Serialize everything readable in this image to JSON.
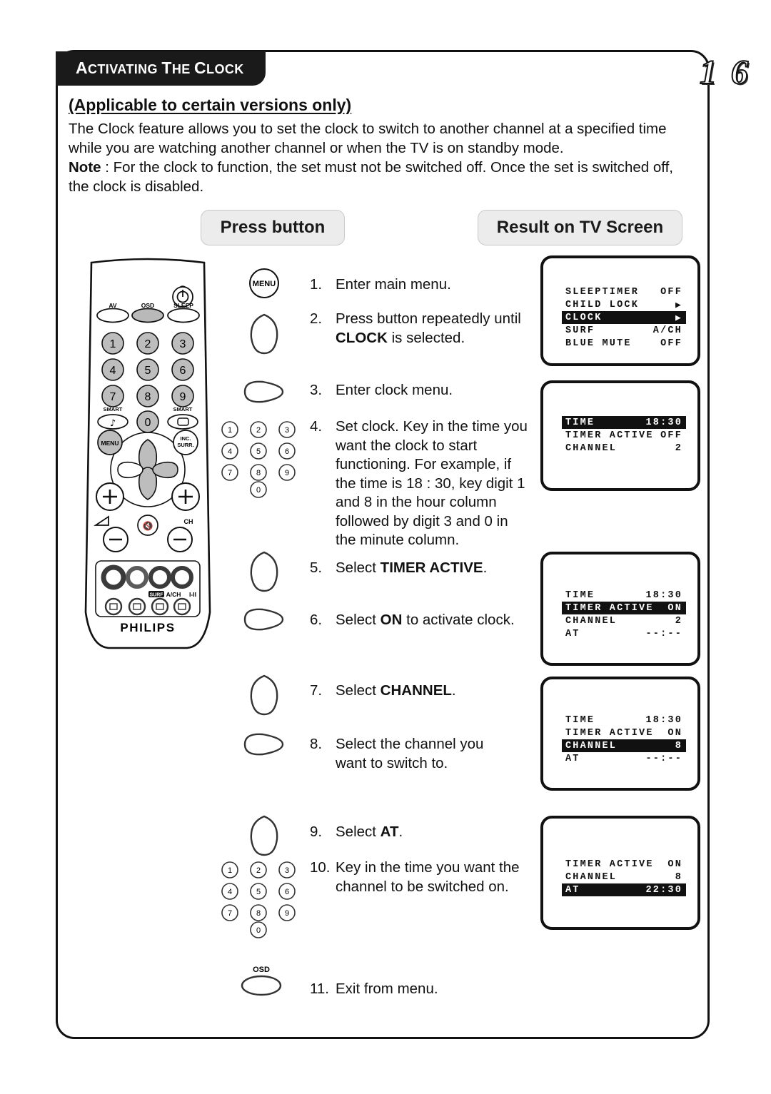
{
  "header": {
    "title_parts": [
      {
        "t": "A",
        "big": true
      },
      {
        "t": "CTIVATING",
        "big": false
      },
      {
        "t": " ",
        "big": false
      },
      {
        "t": "T",
        "big": true
      },
      {
        "t": "HE",
        "big": false
      },
      {
        "t": " ",
        "big": false
      },
      {
        "t": "C",
        "big": true
      },
      {
        "t": "LOCK",
        "big": false
      }
    ],
    "title_plain": "ACTIVATING THE CLOCK",
    "page_number": "1 6"
  },
  "intro": {
    "subtitle": "(Applicable to certain versions only)",
    "paragraph": "The Clock feature allows you to set the clock to switch to another channel at a specified time while you are watching another channel or when the TV is on standby mode.",
    "note_label": "Note",
    "note_text": " : For the clock to function, the set must not be switched off. Once the set is switched off, the clock is disabled."
  },
  "columns": {
    "press_button": "Press button",
    "result_on_tv": "Result on TV Screen"
  },
  "remote": {
    "brand": "PHILIPS",
    "labels": {
      "av": "AV",
      "osd": "OSD",
      "sleep": "SLEEP",
      "smart_sound": "SMART",
      "smart_picture": "SMART",
      "menu": "MENU",
      "inc_surr": "INC. SURR.",
      "inc_surr_line1": "INC.",
      "inc_surr_line2": "SURR.",
      "ch": "CH",
      "surf": "SURF",
      "a_ch": "A/CH",
      "i_ii": "I-II"
    },
    "keypad_digits": [
      "1",
      "2",
      "3",
      "4",
      "5",
      "6",
      "7",
      "8",
      "9",
      "0"
    ]
  },
  "buttons": {
    "menu": "MENU",
    "osd": "OSD",
    "keypad_digits": [
      "1",
      "2",
      "3",
      "4",
      "5",
      "6",
      "7",
      "8",
      "9",
      "0"
    ]
  },
  "steps": [
    {
      "num": "1.",
      "parts": [
        {
          "t": "Enter main menu.",
          "b": false
        }
      ]
    },
    {
      "num": "2.",
      "parts": [
        {
          "t": "Press button repeatedly until ",
          "b": false
        },
        {
          "t": "CLOCK",
          "b": true
        },
        {
          "t": " is selected.",
          "b": false
        }
      ]
    },
    {
      "num": "3.",
      "parts": [
        {
          "t": "Enter clock menu.",
          "b": false
        }
      ]
    },
    {
      "num": "4.",
      "parts": [
        {
          "t": "Set clock. Key in the time you want the clock to start functioning. For example, if the time is 18 : 30, key digit 1 and 8 in the hour column followed by digit 3 and 0 in the minute column.",
          "b": false
        }
      ]
    },
    {
      "num": "5.",
      "parts": [
        {
          "t": "Select ",
          "b": false
        },
        {
          "t": "TIMER ACTIVE",
          "b": true
        },
        {
          "t": ".",
          "b": false
        }
      ]
    },
    {
      "num": "6.",
      "parts": [
        {
          "t": "Select ",
          "b": false
        },
        {
          "t": "ON",
          "b": true
        },
        {
          "t": " to activate clock.",
          "b": false
        }
      ]
    },
    {
      "num": "7.",
      "parts": [
        {
          "t": "Select ",
          "b": false
        },
        {
          "t": "CHANNEL",
          "b": true
        },
        {
          "t": ".",
          "b": false
        }
      ]
    },
    {
      "num": "8.",
      "parts": [
        {
          "t": "Select the channel you want to switch to.",
          "b": false
        }
      ]
    },
    {
      "num": "9.",
      "parts": [
        {
          "t": "Select ",
          "b": false
        },
        {
          "t": "AT",
          "b": true
        },
        {
          "t": ".",
          "b": false
        }
      ]
    },
    {
      "num": "10.",
      "parts": [
        {
          "t": "Key in the time you want the channel to be switched on.",
          "b": false
        }
      ]
    },
    {
      "num": "11.",
      "parts": [
        {
          "t": "Exit from menu.",
          "b": false
        }
      ]
    }
  ],
  "tv_screens": [
    {
      "id": "main-menu",
      "rows": [
        {
          "label": "SLEEPTIMER",
          "value": "OFF",
          "highlight": false,
          "arrow": false
        },
        {
          "label": "CHILD LOCK",
          "value": "",
          "highlight": false,
          "arrow": true
        },
        {
          "label": "CLOCK",
          "value": "",
          "highlight": true,
          "arrow": true
        },
        {
          "label": "SURF",
          "value": "A/CH",
          "highlight": false,
          "arrow": false
        },
        {
          "label": "BLUE MUTE",
          "value": "OFF",
          "highlight": false,
          "arrow": false
        }
      ]
    },
    {
      "id": "clock-time",
      "rows": [
        {
          "label": "TIME",
          "value": "18:30",
          "highlight": true,
          "arrow": false
        },
        {
          "label": "TIMER ACTIVE",
          "value": "OFF",
          "highlight": false,
          "arrow": false
        },
        {
          "label": "CHANNEL",
          "value": "2",
          "highlight": false,
          "arrow": false
        }
      ]
    },
    {
      "id": "timer-active-on",
      "rows": [
        {
          "label": "TIME",
          "value": "18:30",
          "highlight": false,
          "arrow": false
        },
        {
          "label": "TIMER ACTIVE",
          "value": "ON",
          "highlight": true,
          "arrow": false
        },
        {
          "label": "CHANNEL",
          "value": "2",
          "highlight": false,
          "arrow": false
        },
        {
          "label": "AT",
          "value": "--:--",
          "highlight": false,
          "arrow": false
        }
      ]
    },
    {
      "id": "channel-select",
      "rows": [
        {
          "label": "TIME",
          "value": "18:30",
          "highlight": false,
          "arrow": false
        },
        {
          "label": "TIMER ACTIVE",
          "value": "ON",
          "highlight": false,
          "arrow": false
        },
        {
          "label": "CHANNEL",
          "value": "8",
          "highlight": true,
          "arrow": false
        },
        {
          "label": "AT",
          "value": "--:--",
          "highlight": false,
          "arrow": false
        }
      ]
    },
    {
      "id": "at-time",
      "rows": [
        {
          "label": "TIMER ACTIVE",
          "value": "ON",
          "highlight": false,
          "arrow": false
        },
        {
          "label": "CHANNEL",
          "value": "8",
          "highlight": false,
          "arrow": false
        },
        {
          "label": "AT",
          "value": "22:30",
          "highlight": true,
          "arrow": false
        }
      ]
    }
  ]
}
